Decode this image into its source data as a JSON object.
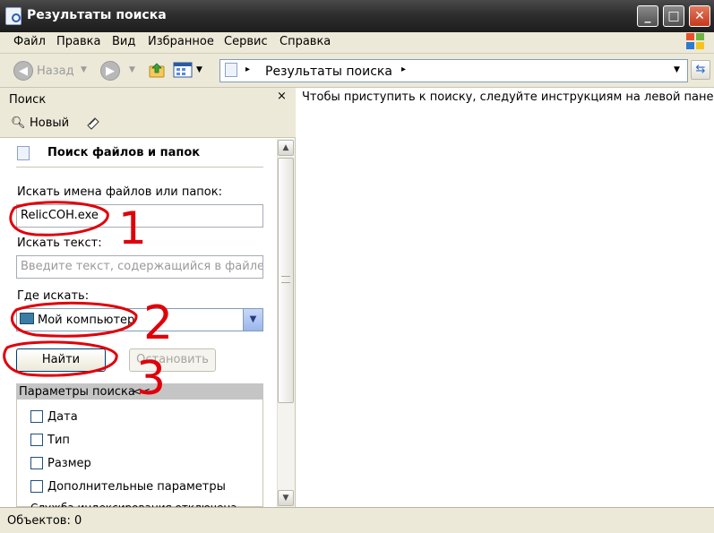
{
  "window": {
    "title": "Результаты поиска"
  },
  "menu": [
    "Файл",
    "Правка",
    "Вид",
    "Избранное",
    "Сервис",
    "Справка"
  ],
  "toolbar": {
    "back_label": "Назад"
  },
  "address": {
    "value": "Результаты поиска"
  },
  "search_pane": {
    "title": "Поиск",
    "close_glyph": "×",
    "new_label": "Новый",
    "section_title": "Поиск файлов и папок",
    "filename_label": "Искать имена файлов или папок:",
    "filename_value": "RelicCOH.exe",
    "text_label": "Искать текст:",
    "text_placeholder": "Введите текст, содержащийся в файле.",
    "where_label": "Где искать:",
    "where_value": "Мой компьютер",
    "find_button": "Найти",
    "stop_button": "Остановить",
    "params_header": "Параметры поиска",
    "params_collapse": "<<",
    "options": [
      "Дата",
      "Тип",
      "Размер",
      "Дополнительные параметры"
    ],
    "cut_text": "Служба индексирования отключена"
  },
  "results": {
    "message": "Чтобы приступить к поиску, следуйте инструкциям на левой панели."
  },
  "status": {
    "objects": "Объектов: 0"
  },
  "annotations": [
    "1",
    "2",
    "3"
  ],
  "colors": {
    "annotation": "#e0000a",
    "titlebar": "#2e2e2e",
    "chrome": "#ece9d8"
  }
}
